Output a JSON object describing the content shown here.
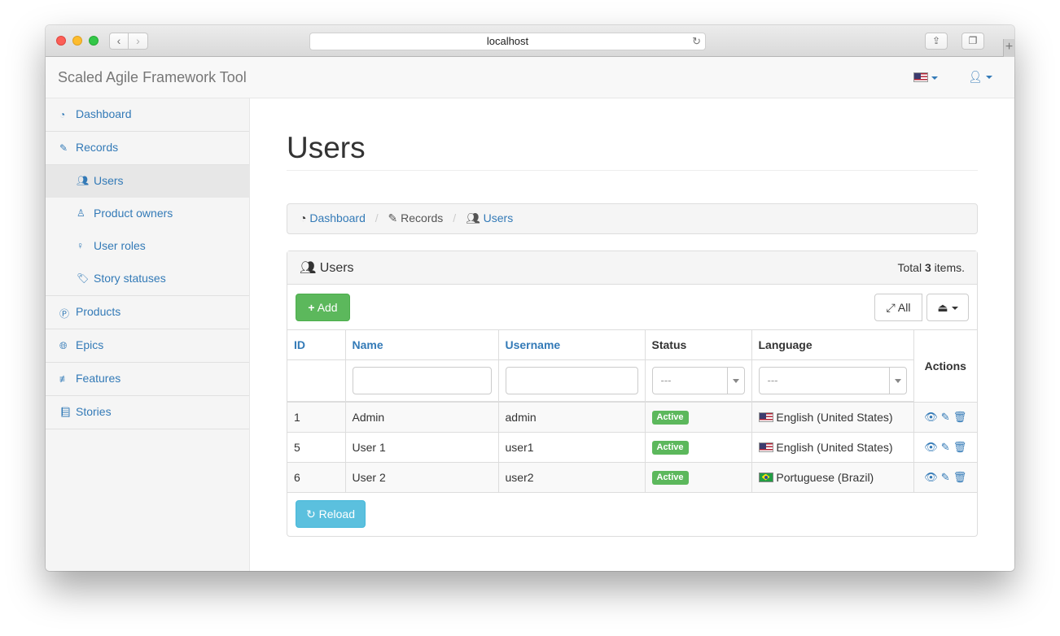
{
  "browser": {
    "url": "localhost"
  },
  "navbar": {
    "brand": "Scaled Agile Framework Tool"
  },
  "sidebar": {
    "items": [
      {
        "label": "Dashboard",
        "icon": "dashboard-icon"
      },
      {
        "label": "Records",
        "icon": "edit-icon"
      },
      {
        "label": "Users",
        "icon": "users-icon"
      },
      {
        "label": "Product owners",
        "icon": "product-owner-icon"
      },
      {
        "label": "User roles",
        "icon": "user-role-icon"
      },
      {
        "label": "Story statuses",
        "icon": "tags-icon"
      },
      {
        "label": "Products",
        "icon": "product-icon"
      },
      {
        "label": "Epics",
        "icon": "globe-icon"
      },
      {
        "label": "Features",
        "icon": "sliders-icon"
      },
      {
        "label": "Stories",
        "icon": "book-icon"
      }
    ],
    "active": "Users"
  },
  "page": {
    "title": "Users"
  },
  "breadcrumb": {
    "items": [
      "Dashboard",
      "Records",
      "Users"
    ],
    "separator": "/"
  },
  "panel": {
    "title": "Users",
    "total_prefix": "Total",
    "total_count": "3",
    "total_suffix": "items."
  },
  "toolbar": {
    "add_label": "Add",
    "all_label": "All",
    "reload_label": "Reload"
  },
  "table": {
    "columns": [
      "ID",
      "Name",
      "Username",
      "Status",
      "Language",
      "Actions"
    ],
    "filters": {
      "status_placeholder": "---",
      "language_placeholder": "---"
    },
    "rows": [
      {
        "id": "1",
        "name": "Admin",
        "username": "admin",
        "status": "Active",
        "language": "English (United States)",
        "flag": "us"
      },
      {
        "id": "5",
        "name": "User 1",
        "username": "user1",
        "status": "Active",
        "language": "English (United States)",
        "flag": "us"
      },
      {
        "id": "6",
        "name": "User 2",
        "username": "user2",
        "status": "Active",
        "language": "Portuguese (Brazil)",
        "flag": "br"
      }
    ]
  },
  "colors": {
    "link": "#337ab7",
    "success": "#5cb85c",
    "info": "#5bc0de"
  }
}
